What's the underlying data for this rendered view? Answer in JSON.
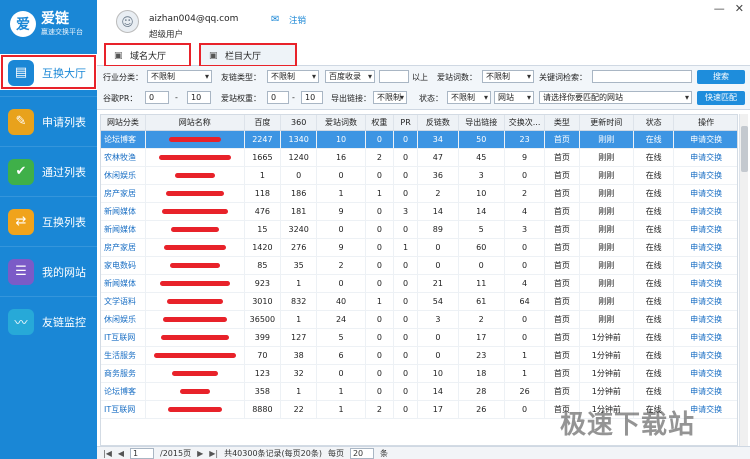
{
  "app": {
    "name": "爱链",
    "subtitle": "赢速交换平台"
  },
  "sidebar": {
    "items": [
      {
        "label": "互换大厅",
        "icon": "hall-icon"
      },
      {
        "label": "申请列表",
        "icon": "apply-list-icon"
      },
      {
        "label": "通过列表",
        "icon": "approved-list-icon"
      },
      {
        "label": "互换列表",
        "icon": "exchange-list-icon"
      },
      {
        "label": "我的网站",
        "icon": "my-sites-icon"
      },
      {
        "label": "友链监控",
        "icon": "monitor-icon"
      }
    ]
  },
  "user": {
    "email": "aizhan004@qq.com",
    "role": "超级用户",
    "logout": "注销"
  },
  "tabs": [
    {
      "label": "域名大厅"
    },
    {
      "label": "栏目大厅"
    }
  ],
  "filters": {
    "industry_label": "行业分类：",
    "industry_value": "不限制",
    "link_type_label": "友链类型：",
    "link_type_value": "不限制",
    "baidu_value": "百度收录",
    "above_label": "以上",
    "aizhan_words_label": "爱站词数：",
    "aizhan_words_value": "不限制",
    "keyword_label": "关键词检索：",
    "search_button": "搜索",
    "pr_label": "谷歌PR：",
    "pr_from": "0",
    "pr_to": "10",
    "weight_label": "爱站权重：",
    "weight_from": "0",
    "weight_to": "10",
    "outlink_label": "导出链接：",
    "outlink_value": "不限制",
    "status_label": "状态：",
    "status_value": "不限制",
    "site_value": "网站",
    "site_select_value": "请选择你要匹配的网站",
    "quick_match_button": "快速匹配"
  },
  "table": {
    "headers": [
      "网站分类",
      "网站名称",
      "百度",
      "360",
      "爱站词数",
      "权重",
      "PR",
      "反链数",
      "导出链接",
      "交换次...",
      "类型",
      "更新时间",
      "状态",
      "操作"
    ],
    "rows": [
      [
        "论坛博客",
        "",
        "2247",
        "1340",
        "10",
        "0",
        "0",
        "34",
        "50",
        "23",
        "首页",
        "刚刚",
        "在线",
        "申请交换"
      ],
      [
        "农林牧渔",
        "",
        "1665",
        "1240",
        "16",
        "2",
        "0",
        "47",
        "45",
        "9",
        "首页",
        "刚刚",
        "在线",
        "申请交换"
      ],
      [
        "休闲娱乐",
        "",
        "1",
        "0",
        "0",
        "0",
        "0",
        "36",
        "3",
        "0",
        "首页",
        "刚刚",
        "在线",
        "申请交换"
      ],
      [
        "房产家居",
        "",
        "118",
        "186",
        "1",
        "1",
        "0",
        "2",
        "10",
        "2",
        "首页",
        "刚刚",
        "在线",
        "申请交换"
      ],
      [
        "新闻媒体",
        "",
        "476",
        "181",
        "9",
        "0",
        "3",
        "14",
        "14",
        "4",
        "首页",
        "刚刚",
        "在线",
        "申请交换"
      ],
      [
        "新闻媒体",
        "",
        "15",
        "3240",
        "0",
        "0",
        "0",
        "89",
        "5",
        "3",
        "首页",
        "刚刚",
        "在线",
        "申请交换"
      ],
      [
        "房产家居",
        "",
        "1420",
        "276",
        "9",
        "0",
        "1",
        "0",
        "60",
        "0",
        "首页",
        "刚刚",
        "在线",
        "申请交换"
      ],
      [
        "家电数码",
        "",
        "85",
        "35",
        "2",
        "0",
        "0",
        "0",
        "0",
        "0",
        "首页",
        "刚刚",
        "在线",
        "申请交换"
      ],
      [
        "新闻媒体",
        "",
        "923",
        "1",
        "0",
        "0",
        "0",
        "21",
        "11",
        "4",
        "首页",
        "刚刚",
        "在线",
        "申请交换"
      ],
      [
        "文学语料",
        "",
        "3010",
        "832",
        "40",
        "1",
        "0",
        "54",
        "61",
        "64",
        "首页",
        "刚刚",
        "在线",
        "申请交换"
      ],
      [
        "休闲娱乐",
        "",
        "36500",
        "1",
        "24",
        "0",
        "0",
        "3",
        "2",
        "0",
        "首页",
        "刚刚",
        "在线",
        "申请交换"
      ],
      [
        "IT互联网",
        "",
        "399",
        "127",
        "5",
        "0",
        "0",
        "0",
        "17",
        "0",
        "首页",
        "1分钟前",
        "在线",
        "申请交换"
      ],
      [
        "生活服务",
        "",
        "70",
        "38",
        "6",
        "0",
        "0",
        "0",
        "23",
        "1",
        "首页",
        "1分钟前",
        "在线",
        "申请交换"
      ],
      [
        "商务服务",
        "",
        "123",
        "32",
        "0",
        "0",
        "0",
        "10",
        "18",
        "1",
        "首页",
        "1分钟前",
        "在线",
        "申请交换"
      ],
      [
        "论坛博客",
        "",
        "358",
        "1",
        "1",
        "0",
        "0",
        "14",
        "28",
        "26",
        "首页",
        "1分钟前",
        "在线",
        "申请交换"
      ],
      [
        "IT互联网",
        "",
        "8880",
        "22",
        "1",
        "2",
        "0",
        "17",
        "26",
        "0",
        "首页",
        "1分钟前",
        "在线",
        "申请交换"
      ]
    ]
  },
  "pager": {
    "page": "1",
    "total_pages": "/2015页",
    "summary": "共40300条记录(每页20条)",
    "per_page_label": "每页",
    "per_page": "20",
    "unit": "条"
  },
  "watermark": "极速下载站",
  "colors": {
    "sidebar": "#1a87d6",
    "selected_row": "#3d95e3",
    "highlight_box": "#e8222a"
  }
}
